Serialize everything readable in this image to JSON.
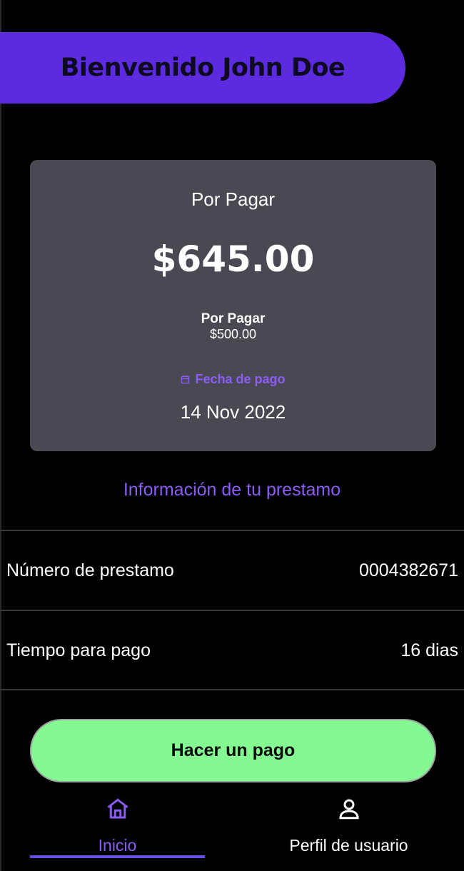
{
  "header": {
    "welcome_text": "Bienvenido John Doe"
  },
  "summary_card": {
    "title": "Por Pagar",
    "total_amount": "$645.00",
    "sub_label": "Por Pagar",
    "sub_amount": "$500.00",
    "date_label": "Fecha de pago",
    "date_value": "14 Nov 2022",
    "date_icon": "calendar-icon"
  },
  "loan_info_link": "Información de tu prestamo",
  "loan_rows": [
    {
      "label": "Número de prestamo",
      "value": "0004382671"
    },
    {
      "label": "Tiempo para pago",
      "value": "16 dias"
    }
  ],
  "pay_button_label": "Hacer un pago",
  "bottom_nav": {
    "items": [
      {
        "label": "Inicio",
        "icon": "home-icon",
        "active": true
      },
      {
        "label": "Perfil de usuario",
        "icon": "user-icon",
        "active": false
      }
    ]
  },
  "colors": {
    "brand_purple": "#5c2be0",
    "accent_purple": "#8a5cf5",
    "card_bg": "#4a4852",
    "pay_button_green": "#84f992",
    "background": "#000000"
  }
}
